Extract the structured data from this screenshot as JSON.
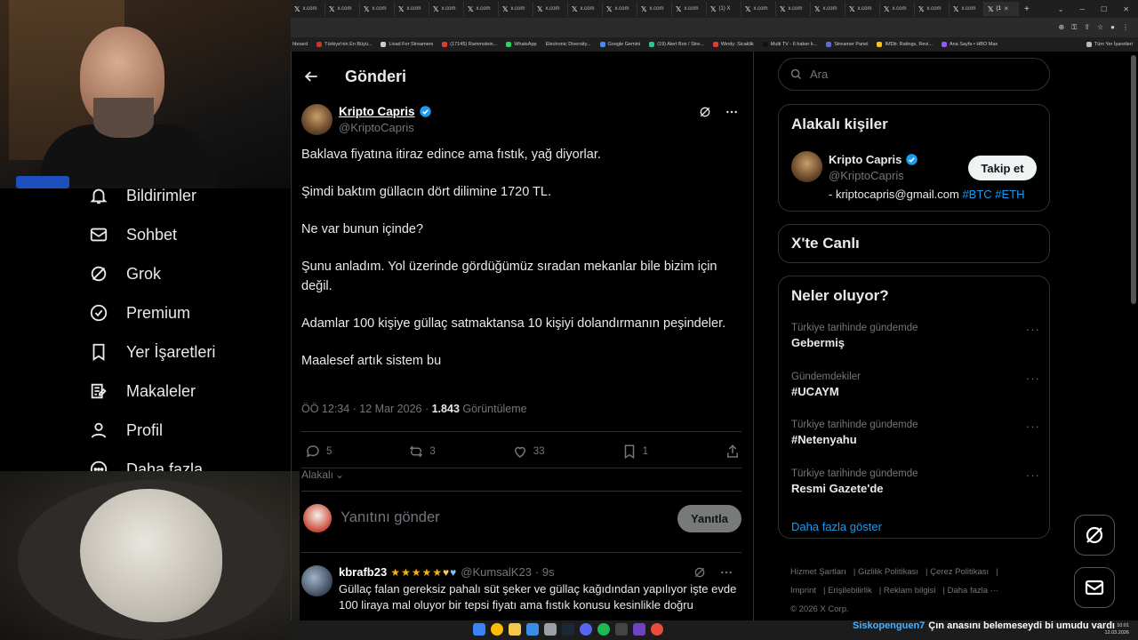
{
  "browser": {
    "tabs": [
      "x.com",
      "x.com",
      "x.com",
      "x.com",
      "x.com",
      "x.com",
      "x.com",
      "x.com",
      "x.com",
      "x.com",
      "x.com",
      "x.com",
      "(1) X",
      "x.com",
      "x.com",
      "x.com",
      "x.com",
      "x.com",
      "x.com",
      "x.com",
      "(1"
    ],
    "bookmarks": [
      "hboard",
      "Türkiye'nin En Büyü...",
      "Livad For Streamers",
      "(17145) Rammstein...",
      "WhatsApp",
      "Electronic Diversity...",
      "Google Gemini",
      "(19) Alert Box / Stre...",
      "Windy: Sicaklik",
      "Multi TV - 6 haber k...",
      "Streamer Panel",
      "IMDb: Ratings, Revi...",
      "Ana Sayfa • HBO Max"
    ],
    "bookmarks_all": "Tüm Yer İşaretleri"
  },
  "nav": {
    "items": [
      {
        "label": "Bildirimler",
        "icon": "bell-icon"
      },
      {
        "label": "Sohbet",
        "icon": "mail-icon"
      },
      {
        "label": "Grok",
        "icon": "grok-icon"
      },
      {
        "label": "Premium",
        "icon": "premium-icon"
      },
      {
        "label": "Yer İşaretleri",
        "icon": "bookmark-icon"
      },
      {
        "label": "Makaleler",
        "icon": "article-icon"
      },
      {
        "label": "Profil",
        "icon": "profile-icon"
      },
      {
        "label": "Daha fazla",
        "icon": "more-icon"
      }
    ]
  },
  "post": {
    "header_title": "Gönderi",
    "author_name": "Kripto Capris",
    "author_handle": "@KriptoCapris",
    "paragraphs": [
      "Baklava fiyatına itiraz edince ama fıstık, yağ diyorlar.",
      "Şimdi baktım güllacın dört dilimine 1720 TL.",
      "Ne var bunun içinde?",
      "Şunu anladım. Yol üzerinde gördüğümüz sıradan mekanlar bile bizim için değil.",
      "Adamlar 100 kişiye güllaç satmaktansa 10 kişiyi dolandırmanın peşindeler.",
      "Maalesef artık sistem bu"
    ],
    "time": "ÖÖ 12:34 · 12 Mar 2026 · ",
    "views": "1.843",
    "views_label": " Görüntüleme",
    "replies": "5",
    "reposts": "3",
    "likes": "33",
    "bookmarks": "1",
    "relevance": "Alakalı"
  },
  "reply": {
    "placeholder": "Yanıtını gönder",
    "button": "Yanıtla"
  },
  "reply_post": {
    "name": "kbrafb23",
    "handle": "@KumsalK23",
    "time": "· 9s",
    "text": "Güllaç falan gereksiz pahalı süt şeker ve güllaç kağıdından yapılıyor işte evde 100 liraya mal oluyor bir tepsi fiyatı ama fıstık konusu kesinlikle doğru"
  },
  "sidebar": {
    "search_placeholder": "Ara",
    "related_title": "Alakalı kişiler",
    "related_name": "Kripto Capris",
    "related_handle": "@KriptoCapris",
    "related_bio": "- kriptocapris@gmail.com ",
    "related_tags": "#BTC #ETH",
    "follow": "Takip et",
    "live_title": "X'te Canlı",
    "trends_title": "Neler oluyor?",
    "trends": [
      {
        "category": "Türkiye tarihinde gündemde",
        "name": "Gebermiş"
      },
      {
        "category": "Gündemdekiler",
        "name": "#UCAYM"
      },
      {
        "category": "Türkiye tarihinde gündemde",
        "name": "#Netenyahu"
      },
      {
        "category": "Türkiye tarihinde gündemde",
        "name": "Resmi Gazete'de"
      }
    ],
    "show_more": "Daha fazla göster",
    "footer": [
      "Hizmet Şartları",
      "Gizlilik Politikası",
      "Çerez Politikası",
      "Imprint",
      "Erişilebilirlik",
      "Reklam bilgisi",
      "Daha fazla ···",
      "© 2026 X Corp."
    ]
  },
  "taskbar": {
    "time": "10:01",
    "date": "12.03.2026"
  },
  "chat": {
    "user": "Siskopenguen7",
    "message": "Çın anasını belemeseydi bi umudu vardı"
  },
  "colors": {
    "accent": "#1d9bf0",
    "background": "#000000",
    "border": "#2f3336",
    "muted": "#71767b"
  }
}
